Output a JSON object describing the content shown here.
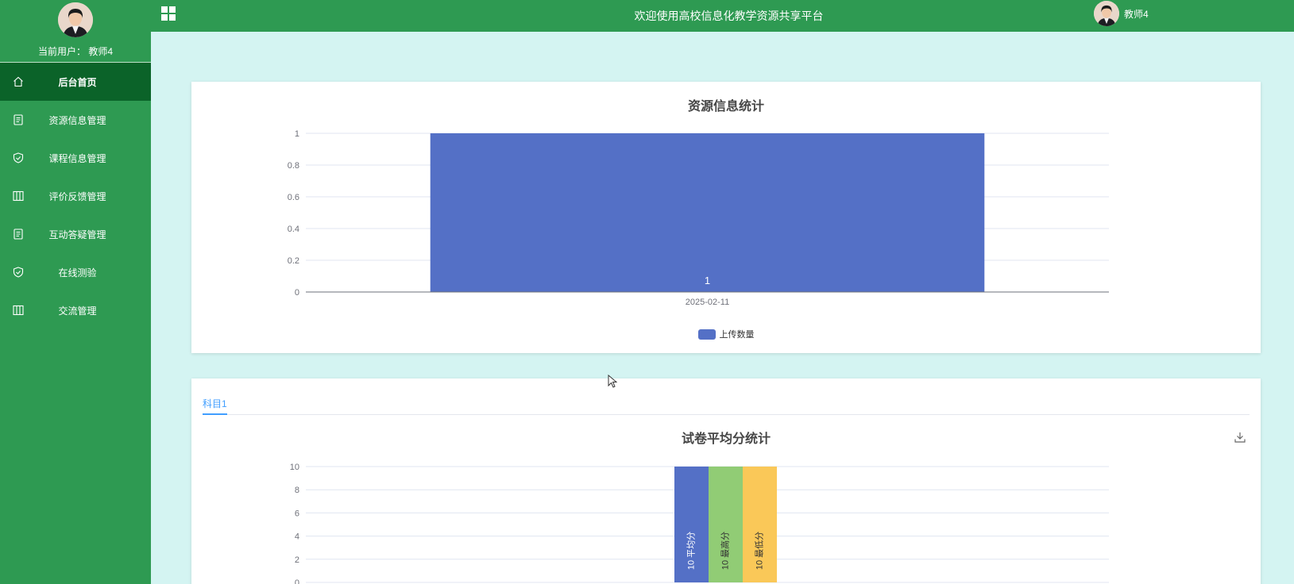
{
  "sidebar": {
    "current_user_label": "当前用户： 教师4",
    "items": [
      {
        "label": "后台首页",
        "icon": "home-icon",
        "active": true
      },
      {
        "label": "资源信息管理",
        "icon": "document-icon"
      },
      {
        "label": "课程信息管理",
        "icon": "shield-check-icon"
      },
      {
        "label": "评价反馈管理",
        "icon": "columns-icon"
      },
      {
        "label": "互动答疑管理",
        "icon": "document-icon"
      },
      {
        "label": "在线测验",
        "icon": "shield-check-icon"
      },
      {
        "label": "交流管理",
        "icon": "columns-icon"
      }
    ]
  },
  "header": {
    "title": "欢迎使用高校信息化教学资源共享平台",
    "user_name": "教师4",
    "menu_icon": "grid-icon"
  },
  "colors": {
    "primary_green": "#2e9a52",
    "active_green": "#0b6329",
    "page_bg": "#d4f4f2",
    "series_blue": "#5470c6",
    "series_green": "#91cc75",
    "series_yellow": "#fac858",
    "tab_blue": "#409eff"
  },
  "chart_data": [
    {
      "type": "bar",
      "title": "资源信息统计",
      "categories": [
        "2025-02-11"
      ],
      "series": [
        {
          "name": "上传数量",
          "values": [
            1
          ]
        }
      ],
      "ylim": [
        0,
        1
      ],
      "yticks": [
        "0",
        "0.2",
        "0.4",
        "0.6",
        "0.8",
        "1"
      ],
      "data_labels": [
        "1"
      ],
      "legend": "bottom-center",
      "grid": true
    },
    {
      "type": "bar",
      "title": "试卷平均分统计",
      "tab": "科目1",
      "series": [
        {
          "name": "平均分",
          "values": [
            10
          ]
        },
        {
          "name": "最高分",
          "values": [
            10
          ]
        },
        {
          "name": "最低分",
          "values": [
            10
          ]
        }
      ],
      "ylim": [
        0,
        10
      ],
      "yticks": [
        "0",
        "2",
        "4",
        "6",
        "8",
        "10"
      ],
      "data_labels": [
        "10 平均分",
        "10 最高分",
        "10 最低分"
      ],
      "grid": true
    }
  ]
}
